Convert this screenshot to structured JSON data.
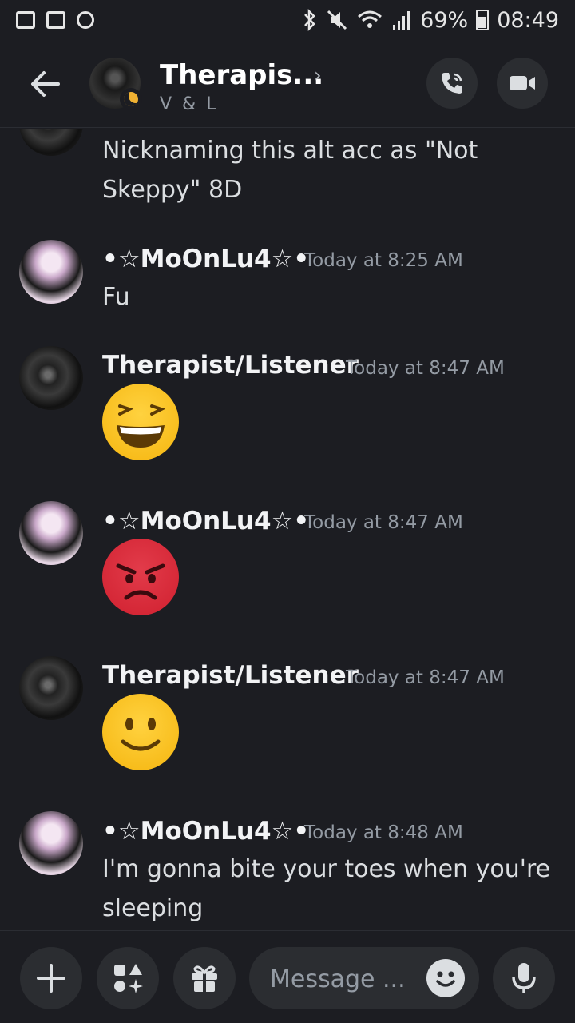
{
  "status_bar": {
    "battery": "69%",
    "time": "08:49"
  },
  "header": {
    "title": "Therapis...",
    "subtitle": "V & L"
  },
  "messages": [
    {
      "text": "Nicknaming this alt acc as \"Not Skeppy\" 8D"
    },
    {
      "author": "•☆MoOnLu4☆•",
      "time": "Today at 8:25 AM",
      "text": "Fu"
    },
    {
      "author": "Therapist/Listener",
      "time": "Today at 8:47 AM",
      "emoji": "grinning-squinting-face"
    },
    {
      "author": "•☆MoOnLu4☆•",
      "time": "Today at 8:47 AM",
      "emoji": "angry-face"
    },
    {
      "author": "Therapist/Listener",
      "time": "Today at 8:47 AM",
      "emoji": "slightly-smiling-face"
    },
    {
      "author": "•☆MoOnLu4☆•",
      "time": "Today at 8:48 AM",
      "text": "I'm gonna bite your toes when you're sleeping"
    }
  ],
  "composer": {
    "placeholder": "Message ..."
  },
  "colors": {
    "background": "#1c1d22",
    "button_bg": "#2b2d31",
    "muted_text": "#949ba4",
    "moon_status": "#f0b132"
  }
}
